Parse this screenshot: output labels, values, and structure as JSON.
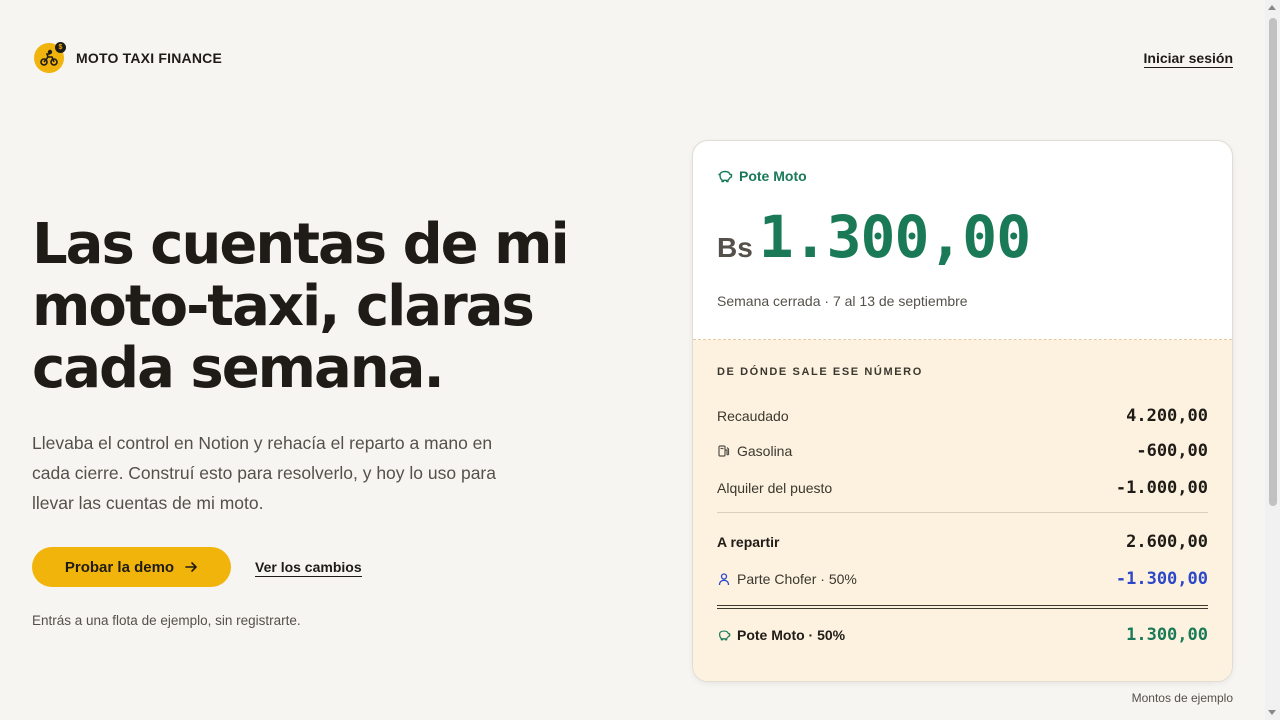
{
  "header": {
    "brand": "MOTO TAXI FINANCE",
    "login_label": "Iniciar sesión"
  },
  "hero": {
    "title_line1": "Las cuentas de mi",
    "title_line2": "moto-taxi, claras",
    "title_line3": "cada semana.",
    "subtitle": "Llevaba el control en Notion y rehacía el reparto a mano en cada cierre. Construí esto para resolverlo, y hoy lo uso para llevar las cuentas de mi moto.",
    "cta_label": "Probar la demo",
    "changes_label": "Ver los cambios",
    "note": "Entrás a una flota de ejemplo, sin registrarte."
  },
  "card": {
    "pote_label": "Pote Moto",
    "currency": "Bs",
    "amount": "1.300,00",
    "week": "Semana cerrada · 7 al 13 de septiembre",
    "section_title": "DE DÓNDE SALE ESE NÚMERO",
    "rows": [
      {
        "label": "Recaudado",
        "value": "4.200,00"
      },
      {
        "label": "Gasolina",
        "value": "-600,00",
        "icon": "fuel-icon"
      },
      {
        "label": "Alquiler del puesto",
        "value": "-1.000,00"
      },
      {
        "label": "A repartir",
        "value": "2.600,00"
      },
      {
        "label": "Parte Chofer · 50%",
        "value": "-1.300,00",
        "icon": "user-icon"
      },
      {
        "label": "Pote Moto · 50%",
        "value": "1.300,00",
        "icon": "piggy-bank-icon"
      }
    ]
  },
  "sample_note": "Montos de ejemplo",
  "colors": {
    "accent_yellow": "#f1b40b",
    "green": "#1a7a58",
    "blue": "#2c47c8",
    "breakdown_bg": "#fdf2e0"
  }
}
